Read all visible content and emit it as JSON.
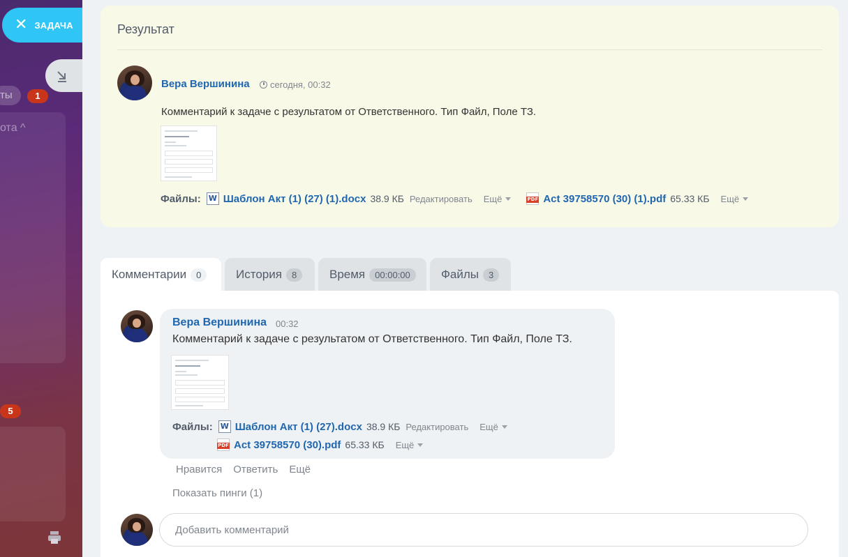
{
  "sidebar": {
    "task_button_label": "ЗАДАЧА",
    "chip_label": "ты",
    "chip_badge": "1",
    "panel_title": "ота",
    "second_badge": "5"
  },
  "result": {
    "title": "Результат",
    "author": "Вера Вершинина",
    "time": "сегодня, 00:32",
    "text": "Комментарий к задаче с результатом от Ответственного. Тип Файл, Поле ТЗ.",
    "files_label": "Файлы:",
    "files": [
      {
        "name": "Шаблон Акт (1) (27) (1).docx",
        "size": "38.9 КБ",
        "edit": "Редактировать",
        "more": "Ещё",
        "type": "doc"
      },
      {
        "name": "Act 39758570 (30) (1).pdf",
        "size": "65.33 КБ",
        "more": "Ещё",
        "type": "pdf"
      }
    ]
  },
  "tabs": [
    {
      "label": "Комментарии",
      "count": "0"
    },
    {
      "label": "История",
      "count": "8"
    },
    {
      "label": "Время",
      "count": "00:00:00"
    },
    {
      "label": "Файлы",
      "count": "3"
    }
  ],
  "comment": {
    "author": "Вера Вершинина",
    "time": "00:32",
    "text": "Комментарий к задаче с результатом от Ответственного. Тип Файл, Поле ТЗ.",
    "files_label": "Файлы:",
    "files": [
      {
        "name": "Шаблон Акт (1) (27).docx",
        "size": "38.9 КБ",
        "edit": "Редактировать",
        "more": "Ещё",
        "type": "doc"
      },
      {
        "name": "Act 39758570 (30).pdf",
        "size": "65.33 КБ",
        "more": "Ещё",
        "type": "pdf"
      }
    ],
    "actions": {
      "like": "Нравится",
      "reply": "Ответить",
      "more": "Ещё"
    },
    "pings": "Показать пинги (1)"
  },
  "add_comment": {
    "placeholder": "Добавить комментарий"
  },
  "colors": {
    "accent": "#2fc6f6",
    "link": "#2067b0",
    "badge": "#c8351b",
    "result_bg": "#f9f9e8"
  }
}
